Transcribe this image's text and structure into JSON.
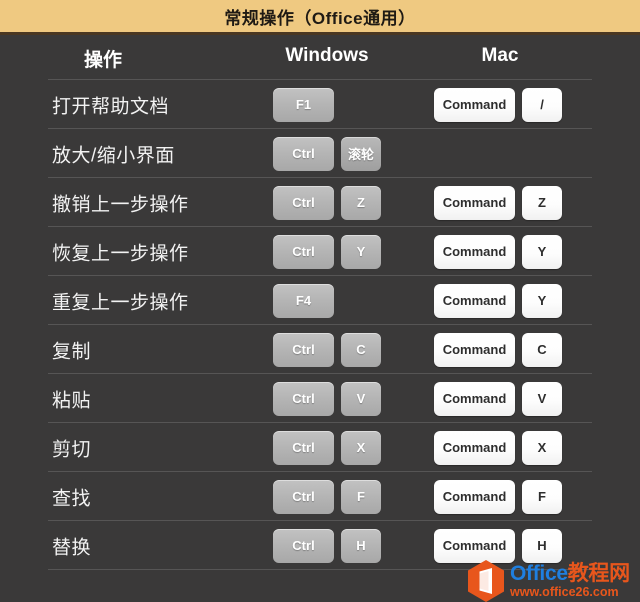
{
  "title": "常规操作（Office通用）",
  "columns": {
    "action": "操作",
    "windows": "Windows",
    "mac": "Mac"
  },
  "rows": [
    {
      "label": "打开帮助文档",
      "win_primary": "F1",
      "win_secondary": "",
      "mac_primary": "Command",
      "mac_secondary": "/"
    },
    {
      "label": "放大/缩小界面",
      "win_primary": "Ctrl",
      "win_secondary": "滚轮",
      "mac_primary": "",
      "mac_secondary": ""
    },
    {
      "label": "撤销上一步操作",
      "win_primary": "Ctrl",
      "win_secondary": "Z",
      "mac_primary": "Command",
      "mac_secondary": "Z"
    },
    {
      "label": "恢复上一步操作",
      "win_primary": "Ctrl",
      "win_secondary": "Y",
      "mac_primary": "Command",
      "mac_secondary": "Y"
    },
    {
      "label": "重复上一步操作",
      "win_primary": "F4",
      "win_secondary": "",
      "mac_primary": "Command",
      "mac_secondary": "Y"
    },
    {
      "label": "复制",
      "win_primary": "Ctrl",
      "win_secondary": "C",
      "mac_primary": "Command",
      "mac_secondary": "C"
    },
    {
      "label": "粘贴",
      "win_primary": "Ctrl",
      "win_secondary": "V",
      "mac_primary": "Command",
      "mac_secondary": "V"
    },
    {
      "label": "剪切",
      "win_primary": "Ctrl",
      "win_secondary": "X",
      "mac_primary": "Command",
      "mac_secondary": "X"
    },
    {
      "label": "查找",
      "win_primary": "Ctrl",
      "win_secondary": "F",
      "mac_primary": "Command",
      "mac_secondary": "F"
    },
    {
      "label": "替换",
      "win_primary": "Ctrl",
      "win_secondary": "H",
      "mac_primary": "Command",
      "mac_secondary": "H"
    }
  ],
  "watermark": {
    "brand_en": "Office",
    "brand_cn": "教程网",
    "url": "www.office26.com",
    "logo": "office-hexagon-logo"
  },
  "colors": {
    "title_bar": "#efc981",
    "title_text": "#1f1a14",
    "title_underline": "#4a3722",
    "body": "#3a3939",
    "separator": "#565555",
    "row_text": "#f2f2f2",
    "win_key": "#b4b4b4",
    "win_key_text": "#ffffff",
    "mac_key": "#ffffff",
    "mac_key_text": "#2e2e2e",
    "watermark_blue": "#1f7fe0",
    "watermark_orange": "#e8561c"
  }
}
